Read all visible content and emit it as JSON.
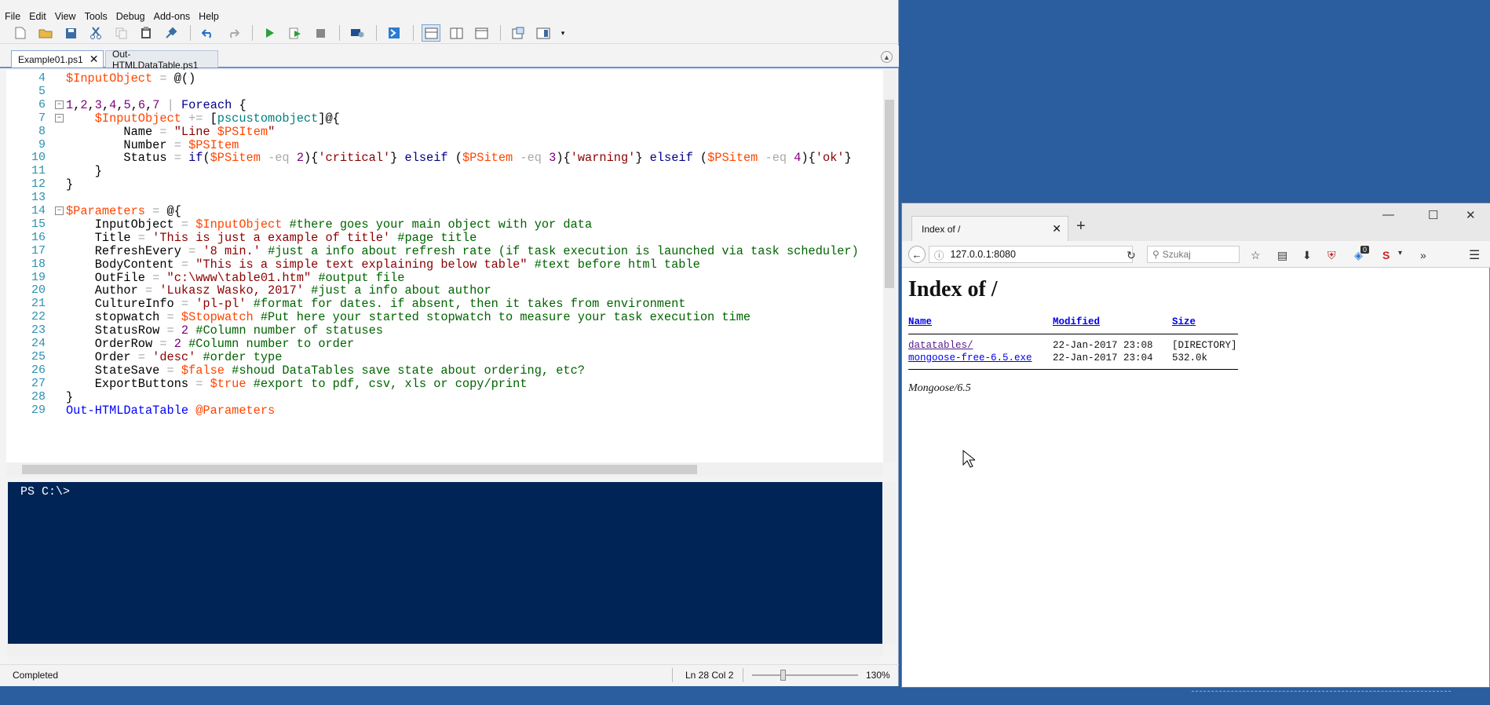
{
  "ise": {
    "menu": [
      "File",
      "Edit",
      "View",
      "Tools",
      "Debug",
      "Add-ons",
      "Help"
    ],
    "tabs": [
      {
        "label": "Example01.ps1",
        "close": "✕"
      },
      {
        "label": "Out-HTMLDataTable.ps1"
      }
    ],
    "console_prompt": "PS C:\\>",
    "status": {
      "text": "Completed",
      "position": "Ln 28  Col 2",
      "zoom": "130%"
    },
    "code_lines": [
      {
        "n": "4",
        "html": "<span class='var'>$InputObject</span> <span class='op'>=</span> @()"
      },
      {
        "n": "5",
        "html": ""
      },
      {
        "n": "6",
        "html": "<span class='num'>1</span>,<span class='num'>2</span>,<span class='num'>3</span>,<span class='num'>4</span>,<span class='num'>5</span>,<span class='num'>6</span>,<span class='num'>7</span> <span class='op'>|</span> <span class='kw'>Foreach</span> {",
        "fold": "−"
      },
      {
        "n": "7",
        "html": "    <span class='var'>$InputObject</span> <span class='op'>+=</span> [<span class='type'>pscustomobject</span>]@{",
        "fold": "−"
      },
      {
        "n": "8",
        "html": "        Name <span class='op'>=</span> <span class='str'>\"Line </span><span class='var'>$PSItem</span><span class='str'>\"</span>"
      },
      {
        "n": "9",
        "html": "        Number <span class='op'>=</span> <span class='var'>$PSItem</span>"
      },
      {
        "n": "10",
        "html": "        Status <span class='op'>=</span> <span class='kw'>if</span>(<span class='var'>$PSitem</span> <span class='op'>-eq</span> <span class='num'>2</span>){<span class='str'>'critical'</span>} <span class='kw'>elseif</span> (<span class='var'>$PSitem</span> <span class='op'>-eq</span> <span class='num'>3</span>){<span class='str'>'warning'</span>} <span class='kw'>elseif</span> (<span class='var'>$PSitem</span> <span class='op'>-eq</span> <span class='num'>4</span>){<span class='str'>'ok'</span>}"
      },
      {
        "n": "11",
        "html": "    }"
      },
      {
        "n": "12",
        "html": "}"
      },
      {
        "n": "13",
        "html": ""
      },
      {
        "n": "14",
        "html": "<span class='var'>$Parameters</span> <span class='op'>=</span> @{",
        "fold": "−"
      },
      {
        "n": "15",
        "html": "    InputObject <span class='op'>=</span> <span class='var'>$InputObject</span> <span class='cmt'>#there goes your main object with yor data</span>"
      },
      {
        "n": "16",
        "html": "    Title <span class='op'>=</span> <span class='str'>'This is just a example of title'</span> <span class='cmt'>#page title</span>"
      },
      {
        "n": "17",
        "html": "    RefreshEvery <span class='op'>=</span> <span class='str'>'8 min.'</span> <span class='cmt'>#just a info about refresh rate (if task execution is launched via task scheduler)</span>"
      },
      {
        "n": "18",
        "html": "    BodyContent <span class='op'>=</span> <span class='str'>\"This is a simple text explaining below table\"</span> <span class='cmt'>#text before html table</span>"
      },
      {
        "n": "19",
        "html": "    OutFile <span class='op'>=</span> <span class='str'>\"c:\\www\\table01.htm\"</span> <span class='cmt'>#output file</span>"
      },
      {
        "n": "20",
        "html": "    Author <span class='op'>=</span> <span class='str'>'Lukasz Wasko, 2017'</span> <span class='cmt'>#just a info about author</span>"
      },
      {
        "n": "21",
        "html": "    CultureInfo <span class='op'>=</span> <span class='str'>'pl-pl'</span> <span class='cmt'>#format for dates. if absent, then it takes from environment</span>"
      },
      {
        "n": "22",
        "html": "    stopwatch <span class='op'>=</span> <span class='var'>$Stopwatch</span> <span class='cmt'>#Put here your started stopwatch to measure your task execution time</span>"
      },
      {
        "n": "23",
        "html": "    StatusRow <span class='op'>=</span> <span class='num'>2</span> <span class='cmt'>#Column number of statuses</span>"
      },
      {
        "n": "24",
        "html": "    OrderRow <span class='op'>=</span> <span class='num'>2</span> <span class='cmt'>#Column number to order</span>"
      },
      {
        "n": "25",
        "html": "    Order <span class='op'>=</span> <span class='str'>'desc'</span> <span class='cmt'>#order type</span>"
      },
      {
        "n": "26",
        "html": "    StateSave <span class='op'>=</span> <span class='var'>$false</span> <span class='cmt'>#shoud DataTables save state about ordering, etc?</span>"
      },
      {
        "n": "27",
        "html": "    ExportButtons <span class='op'>=</span> <span class='var'>$true</span> <span class='cmt'>#export to pdf, csv, xls or copy/print</span>"
      },
      {
        "n": "28",
        "html": "}"
      },
      {
        "n": "29",
        "html": "<span class='cmd'>Out-HTMLDataTable</span> <span class='var'>@Parameters</span>"
      }
    ]
  },
  "browser": {
    "tab_title": "Index of /",
    "url": "127.0.0.1:8080",
    "search_placeholder": "Szukaj",
    "badge_count": "0",
    "heading": "Index of /",
    "columns": [
      "Name",
      "Modified",
      "Size"
    ],
    "rows": [
      {
        "name": "datatables/",
        "modified": "22-Jan-2017 23:08",
        "size": "[DIRECTORY]"
      },
      {
        "name": "mongoose-free-6.5.exe",
        "modified": "22-Jan-2017 23:04",
        "size": "532.0k"
      }
    ],
    "server": "Mongoose/6.5"
  }
}
